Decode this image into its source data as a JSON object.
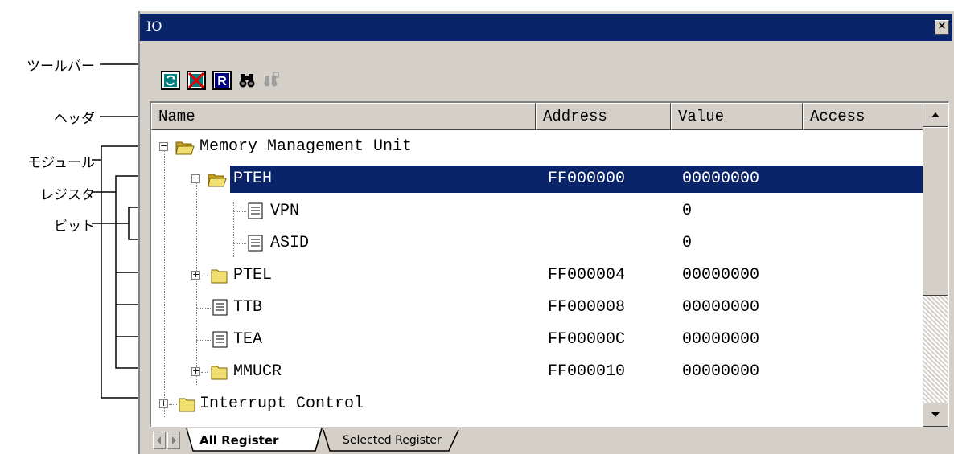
{
  "callouts": {
    "toolbar": "ツールバー",
    "header": "ヘッダ",
    "module": "モジュール",
    "register": "レジスタ",
    "bit": "ビット"
  },
  "window": {
    "title": "IO",
    "close_glyph": "×"
  },
  "toolbar": {
    "buttons": [
      {
        "icon": "refresh-icon",
        "interactable": true
      },
      {
        "icon": "stop-refresh-icon",
        "interactable": true
      },
      {
        "icon": "register-icon",
        "interactable": true
      },
      {
        "icon": "binoculars-icon",
        "interactable": true
      },
      {
        "icon": "disabled-search-icon",
        "interactable": false
      }
    ]
  },
  "columns": [
    "Name",
    "Address",
    "Value",
    "Access"
  ],
  "rows": [
    {
      "name": "Memory Management Unit",
      "address": "",
      "value": "",
      "type": "module",
      "expander": "−"
    },
    {
      "name": "PTEH",
      "address": "FF000000",
      "value": "00000000",
      "type": "register-open",
      "expander": "−",
      "selected": true
    },
    {
      "name": "VPN",
      "address": "",
      "value": "0",
      "type": "bit"
    },
    {
      "name": "ASID",
      "address": "",
      "value": "0",
      "type": "bit"
    },
    {
      "name": "PTEL",
      "address": "FF000004",
      "value": "00000000",
      "type": "register",
      "expander": "+"
    },
    {
      "name": "TTB",
      "address": "FF000008",
      "value": "00000000",
      "type": "leaf"
    },
    {
      "name": "TEA",
      "address": "FF00000C",
      "value": "00000000",
      "type": "leaf"
    },
    {
      "name": "MMUCR",
      "address": "FF000010",
      "value": "00000000",
      "type": "register",
      "expander": "+"
    },
    {
      "name": "Interrupt Control",
      "address": "",
      "value": "",
      "type": "module-closed",
      "expander": "+"
    }
  ],
  "tabs": {
    "active": "All Register",
    "inactive": "Selected Register"
  },
  "colors": {
    "titlebar": "#0a246a",
    "selection": "#0a246a",
    "face": "#d4d0c8",
    "folder": "#e8d860"
  }
}
